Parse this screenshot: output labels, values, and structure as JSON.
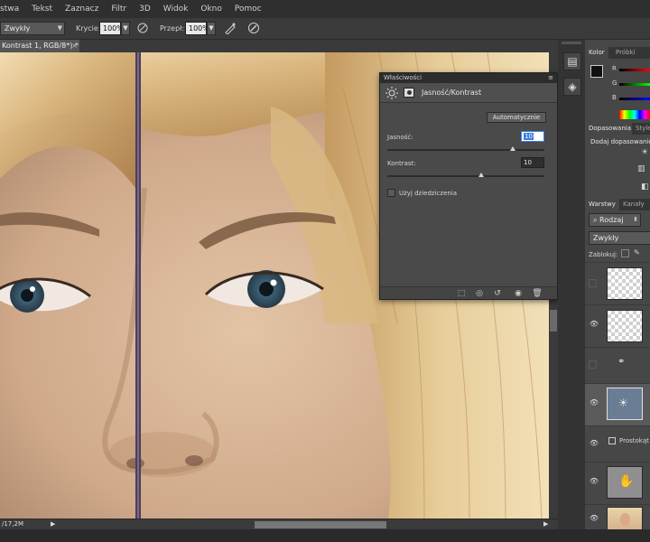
{
  "menu": [
    "stwa",
    "Tekst",
    "Zaznacz",
    "Filtr",
    "3D",
    "Widok",
    "Okno",
    "Pomoc"
  ],
  "options": {
    "mode_value": "Zwykły",
    "opacity_label": "Krycie:",
    "opacity_value": "100%",
    "flow_label": "Przepł:",
    "flow_value": "100%"
  },
  "document": {
    "tab_title": "Kontrast 1, RGB/8*) *",
    "close_symbol": "×",
    "status_text": "/17,2M",
    "status_arrow": "▶"
  },
  "properties": {
    "panel_title": "Właściwości",
    "title": "Jasność/Kontrast",
    "auto_button": "Automatycznie",
    "brightness_label": "Jasność:",
    "brightness_value": "10",
    "brightness_fraction": 0.8,
    "contrast_label": "Kontrast:",
    "contrast_value": "10",
    "contrast_fraction": 0.6,
    "legacy_label": "Użyj dziedziczenia",
    "legacy_checked": false
  },
  "color_panel": {
    "tab_active": "Kolor",
    "tab_inactive": "Próbki",
    "channel_r": "R",
    "channel_g": "G",
    "channel_b": "B"
  },
  "adjustments_panel": {
    "tab_active": "Dopasowania",
    "tab_inactive": "Style",
    "add_label": "Dodaj dopasowanie"
  },
  "layers_panel": {
    "tab_active": "Warstwy",
    "tab_inactive": "Kanały",
    "filter_value": "Rodzaj",
    "blend_value": "Zwykły",
    "lock_label": "Zablokuj:",
    "shape_layer_name": "Prostokąt"
  },
  "icons": {
    "brush": "brush-icon",
    "airbrush": "airbrush-icon",
    "pressure": "pressure-icon",
    "sun": "brightness-contrast-icon",
    "eye": "eye-icon",
    "history": "history-icon",
    "layers": "layers-icon"
  },
  "colors": {
    "accent_field": "#3d7de0",
    "adjustment_thumb": "#6b7d95"
  }
}
